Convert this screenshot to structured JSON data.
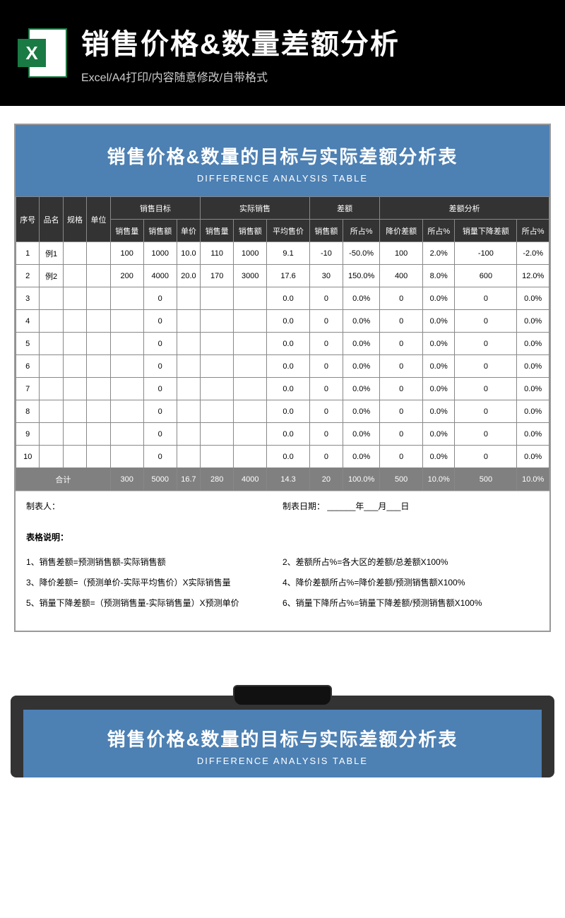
{
  "header": {
    "title": "销售价格&数量差额分析",
    "subtitle": "Excel/A4打印/内容随意修改/自带格式"
  },
  "banner": {
    "title": "销售价格&数量的目标与实际差额分析表",
    "subtitle": "DIFFERENCE ANALYSIS TABLE"
  },
  "columns": {
    "seq": "序号",
    "name": "品名",
    "spec": "规格",
    "unit": "单位",
    "group_target": "销售目标",
    "group_actual": "实际销售",
    "group_diff": "差额",
    "group_analysis": "差额分析",
    "t_qty": "销售量",
    "t_amt": "销售额",
    "t_price": "单价",
    "a_qty": "销售量",
    "a_amt": "销售额",
    "a_price": "平均售价",
    "d_amt": "销售额",
    "d_pct": "所占%",
    "an_price_diff": "降价差额",
    "an_price_pct": "所占%",
    "an_qty_diff": "销量下降差额",
    "an_qty_pct": "所占%"
  },
  "rows": [
    {
      "seq": "1",
      "name": "例1",
      "spec": "",
      "unit": "",
      "t_qty": "100",
      "t_amt": "1000",
      "t_price": "10.0",
      "a_qty": "110",
      "a_amt": "1000",
      "a_price": "9.1",
      "d_amt": "-10",
      "d_pct": "-50.0%",
      "an_price_diff": "100",
      "an_price_pct": "2.0%",
      "an_qty_diff": "-100",
      "an_qty_pct": "-2.0%"
    },
    {
      "seq": "2",
      "name": "例2",
      "spec": "",
      "unit": "",
      "t_qty": "200",
      "t_amt": "4000",
      "t_price": "20.0",
      "a_qty": "170",
      "a_amt": "3000",
      "a_price": "17.6",
      "d_amt": "30",
      "d_pct": "150.0%",
      "an_price_diff": "400",
      "an_price_pct": "8.0%",
      "an_qty_diff": "600",
      "an_qty_pct": "12.0%"
    },
    {
      "seq": "3",
      "name": "",
      "spec": "",
      "unit": "",
      "t_qty": "",
      "t_amt": "0",
      "t_price": "",
      "a_qty": "",
      "a_amt": "",
      "a_price": "0.0",
      "d_amt": "0",
      "d_pct": "0.0%",
      "an_price_diff": "0",
      "an_price_pct": "0.0%",
      "an_qty_diff": "0",
      "an_qty_pct": "0.0%"
    },
    {
      "seq": "4",
      "name": "",
      "spec": "",
      "unit": "",
      "t_qty": "",
      "t_amt": "0",
      "t_price": "",
      "a_qty": "",
      "a_amt": "",
      "a_price": "0.0",
      "d_amt": "0",
      "d_pct": "0.0%",
      "an_price_diff": "0",
      "an_price_pct": "0.0%",
      "an_qty_diff": "0",
      "an_qty_pct": "0.0%"
    },
    {
      "seq": "5",
      "name": "",
      "spec": "",
      "unit": "",
      "t_qty": "",
      "t_amt": "0",
      "t_price": "",
      "a_qty": "",
      "a_amt": "",
      "a_price": "0.0",
      "d_amt": "0",
      "d_pct": "0.0%",
      "an_price_diff": "0",
      "an_price_pct": "0.0%",
      "an_qty_diff": "0",
      "an_qty_pct": "0.0%"
    },
    {
      "seq": "6",
      "name": "",
      "spec": "",
      "unit": "",
      "t_qty": "",
      "t_amt": "0",
      "t_price": "",
      "a_qty": "",
      "a_amt": "",
      "a_price": "0.0",
      "d_amt": "0",
      "d_pct": "0.0%",
      "an_price_diff": "0",
      "an_price_pct": "0.0%",
      "an_qty_diff": "0",
      "an_qty_pct": "0.0%"
    },
    {
      "seq": "7",
      "name": "",
      "spec": "",
      "unit": "",
      "t_qty": "",
      "t_amt": "0",
      "t_price": "",
      "a_qty": "",
      "a_amt": "",
      "a_price": "0.0",
      "d_amt": "0",
      "d_pct": "0.0%",
      "an_price_diff": "0",
      "an_price_pct": "0.0%",
      "an_qty_diff": "0",
      "an_qty_pct": "0.0%"
    },
    {
      "seq": "8",
      "name": "",
      "spec": "",
      "unit": "",
      "t_qty": "",
      "t_amt": "0",
      "t_price": "",
      "a_qty": "",
      "a_amt": "",
      "a_price": "0.0",
      "d_amt": "0",
      "d_pct": "0.0%",
      "an_price_diff": "0",
      "an_price_pct": "0.0%",
      "an_qty_diff": "0",
      "an_qty_pct": "0.0%"
    },
    {
      "seq": "9",
      "name": "",
      "spec": "",
      "unit": "",
      "t_qty": "",
      "t_amt": "0",
      "t_price": "",
      "a_qty": "",
      "a_amt": "",
      "a_price": "0.0",
      "d_amt": "0",
      "d_pct": "0.0%",
      "an_price_diff": "0",
      "an_price_pct": "0.0%",
      "an_qty_diff": "0",
      "an_qty_pct": "0.0%"
    },
    {
      "seq": "10",
      "name": "",
      "spec": "",
      "unit": "",
      "t_qty": "",
      "t_amt": "0",
      "t_price": "",
      "a_qty": "",
      "a_amt": "",
      "a_price": "0.0",
      "d_amt": "0",
      "d_pct": "0.0%",
      "an_price_diff": "0",
      "an_price_pct": "0.0%",
      "an_qty_diff": "0",
      "an_qty_pct": "0.0%"
    }
  ],
  "totals": {
    "label": "合计",
    "t_qty": "300",
    "t_amt": "5000",
    "t_price": "16.7",
    "a_qty": "280",
    "a_amt": "4000",
    "a_price": "14.3",
    "d_amt": "20",
    "d_pct": "100.0%",
    "an_price_diff": "500",
    "an_price_pct": "10.0%",
    "an_qty_diff": "500",
    "an_qty_pct": "10.0%"
  },
  "meta": {
    "maker_label": "制表人：",
    "date_label": "制表日期： ______年___月___日"
  },
  "notes": {
    "title": "表格说明：",
    "items": [
      "1、销售差额=预测销售额-实际销售额",
      "2、差额所占%=各大区的差额/总差额X100%",
      "3、降价差额=（预测单价-实际平均售价）X实际销售量",
      "4、降价差额所占%=降价差额/预测销售额X100%",
      "5、销量下降差额=（预测销售量-实际销售量）X预测单价",
      "6、销量下降所占%=销量下降差额/预测销售额X100%"
    ]
  }
}
